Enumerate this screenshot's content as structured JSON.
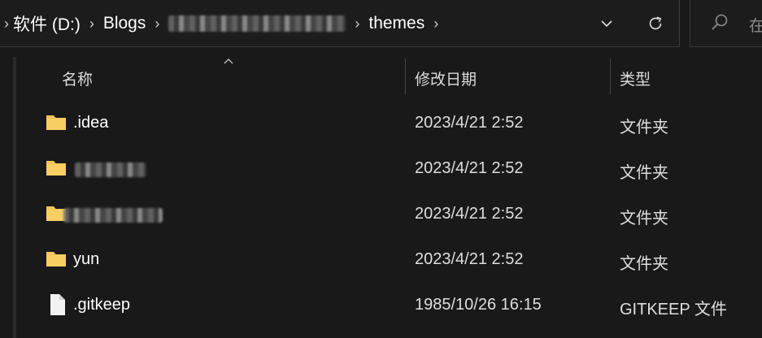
{
  "address_bar": {
    "crumbs": [
      {
        "label": "软件 (D:)"
      },
      {
        "label": "Blogs"
      },
      {
        "label": ""
      },
      {
        "label": "themes"
      }
    ]
  },
  "search": {
    "placeholder": "在"
  },
  "columns": {
    "name": "名称",
    "date": "修改日期",
    "type": "类型"
  },
  "files": [
    {
      "kind": "folder",
      "name": ".idea",
      "date": "2023/4/21 2:52",
      "type": "文件夹",
      "obscured": false
    },
    {
      "kind": "folder",
      "name": "",
      "date": "2023/4/21 2:52",
      "type": "文件夹",
      "obscured": true
    },
    {
      "kind": "folder",
      "name": "",
      "date": "2023/4/21 2:52",
      "type": "文件夹",
      "obscured": true
    },
    {
      "kind": "folder",
      "name": "yun",
      "date": "2023/4/21 2:52",
      "type": "文件夹",
      "obscured": false
    },
    {
      "kind": "file",
      "name": ".gitkeep",
      "date": "1985/10/26 16:15",
      "type": "GITKEEP 文件",
      "obscured": false
    }
  ],
  "colors": {
    "background": "#191919",
    "folder": "#f4c55b",
    "text": "#ffffff",
    "divider": "#444444"
  },
  "icons": [
    "chevron-right-icon",
    "chevron-down-icon",
    "refresh-icon",
    "search-icon",
    "folder-icon",
    "file-icon",
    "sort-up-icon"
  ]
}
